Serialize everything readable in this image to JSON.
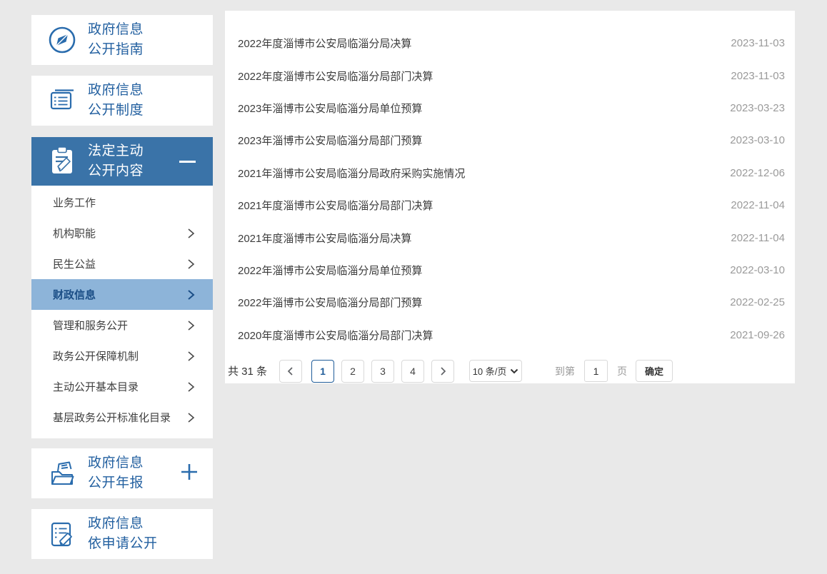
{
  "accent_colors": {
    "icon_blue": "#2a6cad",
    "title_blue": "#2360a0",
    "selected_header_bg": "#3a73a8",
    "active_submenu_bg": "#8db4d9",
    "active_submenu_text": "#1b4e86",
    "date_gray": "#9a9a9a"
  },
  "sidebar": {
    "cards": [
      {
        "id": "guide",
        "icon": "compass-icon",
        "lines": [
          "政府信息",
          "公开指南"
        ]
      },
      {
        "id": "system",
        "icon": "notebook-icon",
        "lines": [
          "政府信息",
          "公开制度"
        ]
      },
      {
        "id": "statutory",
        "icon": "clipboard-pen-icon",
        "lines": [
          "法定主动",
          "公开内容"
        ],
        "toggle": "collapse-minus"
      },
      {
        "id": "annual",
        "icon": "folder-report-icon",
        "lines": [
          "政府信息",
          "公开年报"
        ],
        "toggle": "expand-plus"
      },
      {
        "id": "apply",
        "icon": "document-pen-icon",
        "lines": [
          "政府信息",
          "依申请公开"
        ]
      }
    ],
    "menu_items": [
      {
        "label": "业务工作",
        "arrow": false,
        "active": false
      },
      {
        "label": "机构职能",
        "arrow": true,
        "active": false
      },
      {
        "label": "民生公益",
        "arrow": true,
        "active": false
      },
      {
        "label": "财政信息",
        "arrow": true,
        "active": true
      },
      {
        "label": "管理和服务公开",
        "arrow": true,
        "active": false
      },
      {
        "label": "政务公开保障机制",
        "arrow": true,
        "active": false
      },
      {
        "label": "主动公开基本目录",
        "arrow": true,
        "active": false
      },
      {
        "label": "基层政务公开标准化目录",
        "arrow": true,
        "active": false
      }
    ]
  },
  "list": {
    "rows": [
      {
        "title": "2022年度淄博市公安局临淄分局决算",
        "date": "2023-11-03"
      },
      {
        "title": "2022年度淄博市公安局临淄分局部门决算",
        "date": "2023-11-03"
      },
      {
        "title": "2023年淄博市公安局临淄分局单位预算",
        "date": "2023-03-23"
      },
      {
        "title": "2023年淄博市公安局临淄分局部门预算",
        "date": "2023-03-10"
      },
      {
        "title": "2021年淄博市公安局临淄分局政府采购实施情况",
        "date": "2022-12-06"
      },
      {
        "title": "2021年度淄博市公安局临淄分局部门决算",
        "date": "2022-11-04"
      },
      {
        "title": "2021年度淄博市公安局临淄分局决算",
        "date": "2022-11-04"
      },
      {
        "title": "2022年淄博市公安局临淄分局单位预算",
        "date": "2022-03-10"
      },
      {
        "title": "2022年淄博市公安局临淄分局部门预算",
        "date": "2022-02-25"
      },
      {
        "title": "2020年度淄博市公安局临淄分局部门决算",
        "date": "2021-09-26"
      }
    ]
  },
  "pagination": {
    "total_text": "共 31 条",
    "pages": [
      "1",
      "2",
      "3",
      "4"
    ],
    "active_page": "1",
    "page_size_label": "10 条/页",
    "goto_prefix": "到第",
    "goto_value": "1",
    "goto_suffix": "页",
    "confirm_label": "确定"
  }
}
